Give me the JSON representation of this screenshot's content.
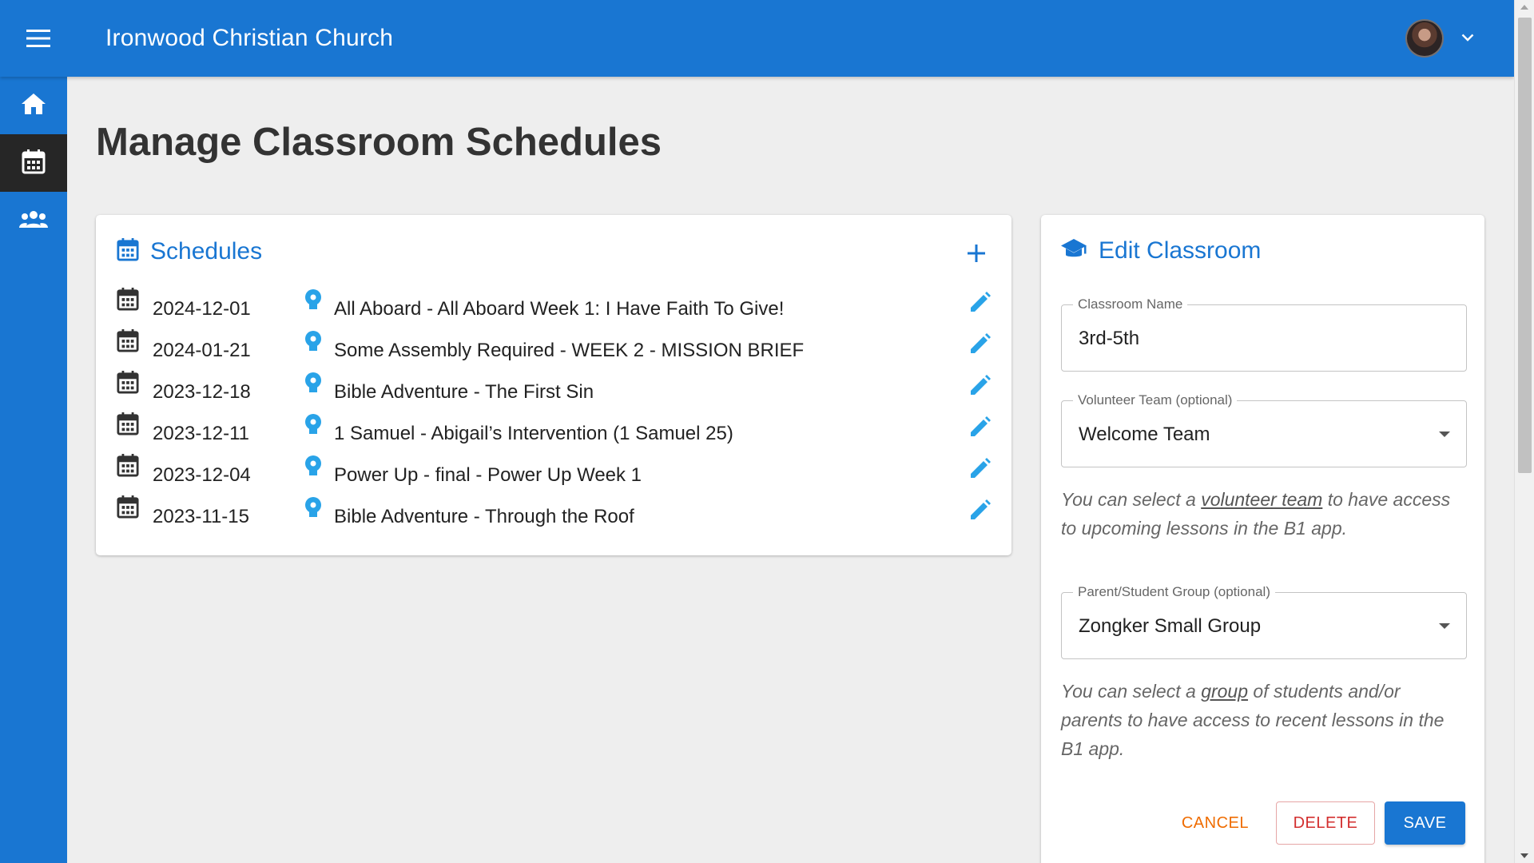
{
  "app": {
    "title": "Ironwood Christian Church"
  },
  "page": {
    "title": "Manage Classroom Schedules"
  },
  "schedules": {
    "title": "Schedules",
    "items": [
      {
        "date": "2024-12-01",
        "name": "All Aboard - All Aboard Week 1: I Have Faith To Give!"
      },
      {
        "date": "2024-01-21",
        "name": "Some Assembly Required - WEEK 2 - MISSION BRIEF"
      },
      {
        "date": "2023-12-18",
        "name": "Bible Adventure - The First Sin"
      },
      {
        "date": "2023-12-11",
        "name": "1 Samuel - Abigail’s Intervention (1 Samuel 25)"
      },
      {
        "date": "2023-12-04",
        "name": "Power Up - final - Power Up Week 1"
      },
      {
        "date": "2023-11-15",
        "name": "Bible Adventure - Through the Roof"
      }
    ]
  },
  "edit": {
    "title": "Edit Classroom",
    "classroom_name": {
      "label": "Classroom Name",
      "value": "3rd-5th"
    },
    "volunteer_team": {
      "label": "Volunteer Team (optional)",
      "value": "Welcome Team"
    },
    "volunteer_help": {
      "before": "You can select a ",
      "link": "volunteer team",
      "after": " to have access to upcoming lessons in the B1 app."
    },
    "group": {
      "label": "Parent/Student Group (optional)",
      "value": "Zongker Small Group"
    },
    "group_help": {
      "before": "You can select a ",
      "link": "group",
      "after": " of students and/or parents to have access to recent lessons in the B1 app."
    },
    "buttons": {
      "cancel": "CANCEL",
      "delete": "DELETE",
      "save": "SAVE"
    }
  },
  "colors": {
    "primary": "#1976d2",
    "sidebar_active": "#262626",
    "cancel": "#ef6c00",
    "delete": "#d32f2f",
    "accent_icon": "#29a3e8",
    "background": "#eeeeee"
  },
  "icons": {
    "menu": "menu-icon",
    "account_dropdown": "chevron-down-icon",
    "home": "home-icon",
    "calendar": "calendar-icon",
    "people": "people-icon",
    "add": "plus-icon",
    "lesson": "lightbulb-icon",
    "edit": "pencil-icon",
    "school": "school-icon"
  }
}
